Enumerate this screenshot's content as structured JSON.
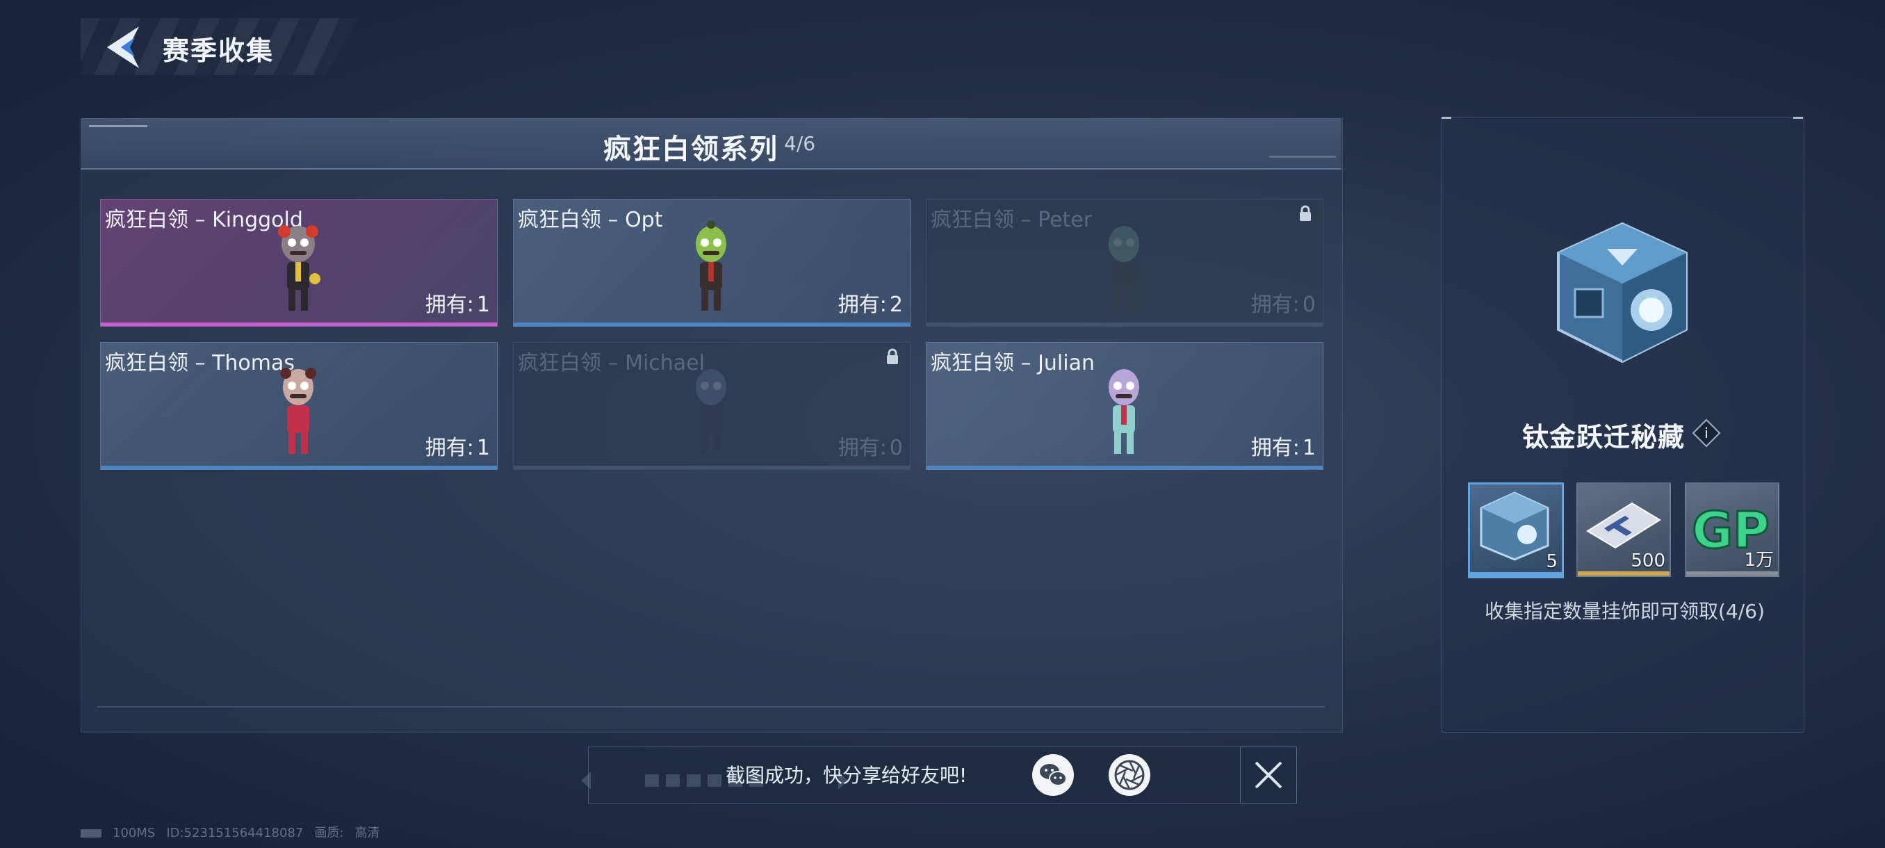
{
  "header": {
    "title": "赛季收集"
  },
  "series": {
    "title": "疯狂白领系列",
    "count": "4/6"
  },
  "cards": [
    {
      "name": "疯狂白领 – Kinggold",
      "own_label": "拥有:",
      "own_value": "1",
      "state": "owned",
      "rarity_color": "#c95fd2"
    },
    {
      "name": "疯狂白领 – Opt",
      "own_label": "拥有:",
      "own_value": "2",
      "state": "owned",
      "rarity_color": "#4a86c8"
    },
    {
      "name": "疯狂白领 – Peter",
      "own_label": "拥有:",
      "own_value": "0",
      "state": "locked"
    },
    {
      "name": "疯狂白领 – Thomas",
      "own_label": "拥有:",
      "own_value": "1",
      "state": "owned",
      "rarity_color": "#4a86c8"
    },
    {
      "name": "疯狂白领 – Michael",
      "own_label": "拥有:",
      "own_value": "0",
      "state": "locked"
    },
    {
      "name": "疯狂白领 – Julian",
      "own_label": "拥有:",
      "own_value": "1",
      "state": "owned",
      "rarity_color": "#4a86c8"
    }
  ],
  "reward": {
    "name": "钛金跃迁秘藏",
    "info_icon": "i",
    "items": [
      {
        "icon": "cube-icon",
        "qty": "5",
        "color": "#5fa4e0"
      },
      {
        "icon": "card-icon",
        "qty": "500",
        "color": "#d1a84b"
      },
      {
        "icon": "gp-icon",
        "qty": "1万",
        "color": "#8a8f99"
      }
    ],
    "description": "收集指定数量挂饰即可领取(4/6)"
  },
  "share": {
    "text": "截图成功，快分享给好友吧!"
  },
  "footer": {
    "ping": "100MS",
    "id": "ID:523151564418087",
    "quality_label": "画质:",
    "quality_value": "高清"
  }
}
